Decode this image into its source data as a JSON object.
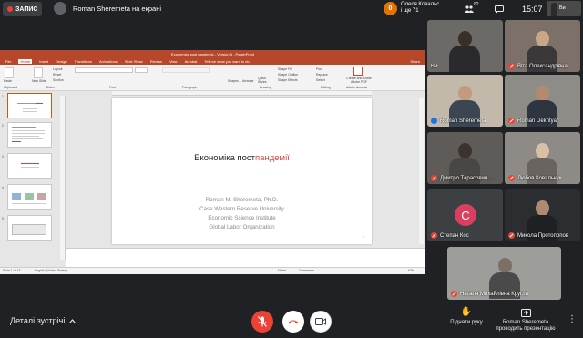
{
  "topbar": {
    "rec_label": "ЗАПИС",
    "presenting_label": "Roman Sheremeta на екрані",
    "notification_count": "0",
    "notification_name": "Олеся Ковальс…",
    "notification_more": "і ще 71",
    "people_count": "82",
    "clock": "15:07",
    "self_label": "Ви"
  },
  "ppt": {
    "window_title": "Economics post pandemic - Version 3 - PowerPoint",
    "tabs": [
      "File",
      "Home",
      "Insert",
      "Design",
      "Transitions",
      "Animations",
      "Slide Show",
      "Review",
      "View",
      "Acrobat"
    ],
    "tell_me": "Tell me what you want to do",
    "share": "Share",
    "ribbon": {
      "paste": "Paste",
      "new_slide": "New Slide",
      "layout": "Layout",
      "reset": "Reset",
      "section": "Section",
      "clipboard": "Clipboard",
      "slides": "Slides",
      "font": "Font",
      "paragraph": "Paragraph",
      "drawing": "Drawing",
      "shapes": "Shapes",
      "arrange": "Arrange",
      "quick_styles": "Quick Styles",
      "shape_fill": "Shape Fill",
      "shape_outline": "Shape Outline",
      "shape_effects": "Shape Effects",
      "find": "Find",
      "replace": "Replace",
      "select": "Select",
      "editing": "Editing",
      "create_share": "Create and Share Adobe PDF",
      "adobe_acrobat": "Adobe Acrobat"
    },
    "slide": {
      "title_pre": "Економіка пост",
      "title_highlight": "пандемії",
      "lines": [
        "Roman M. Sheremeta, Ph.D.",
        "Case Western Reserve University",
        "Economic Science Institute",
        "Global Labor Organization"
      ],
      "page_number": "1"
    },
    "thumb_numbers": [
      "1",
      "2",
      "3",
      "4",
      "5"
    ],
    "status": {
      "slide_of": "Slide 1 of 13",
      "language": "English (United States)",
      "notes": "Notes",
      "comments": "Comments",
      "zoom": "63%"
    }
  },
  "participants": [
    {
      "name": "Ви",
      "muted": false,
      "speaking": false,
      "bg": "#6b6a66",
      "head": "#3a2e28",
      "torso": "#2a2a2e"
    },
    {
      "name": "Віта Олександрівна",
      "muted": true,
      "bg": "#7d7069",
      "head": "#c9a58a",
      "torso": "#3a3838"
    },
    {
      "name": "Roman Sheremeta",
      "muted": false,
      "speaking": true,
      "bg": "#c2b9aa",
      "head": "#c49a7e",
      "torso": "#3b4652"
    },
    {
      "name": "Roman Dekhtyar",
      "muted": true,
      "bg": "#8d8c87",
      "head": "#b48a6e",
      "torso": "#2e3440"
    },
    {
      "name": "Дмитро Тарасович …",
      "muted": true,
      "bg": "#5e5b58",
      "head": "#3a3330",
      "torso": "#4a4646"
    },
    {
      "name": "Любов Ковальчук",
      "muted": true,
      "bg": "#8e8a86",
      "head": "#d8c0a8",
      "torso": "#6a6461"
    },
    {
      "name": "Степан Кос",
      "muted": true,
      "avatar_letter": "С",
      "bg": "#3c4043"
    },
    {
      "name": "Микола Протопопов",
      "muted": true,
      "bg": "#2b2d31",
      "head": "#b08a70",
      "torso": "#1e2024"
    },
    {
      "name": "Наталя Михайлівна Кругла",
      "muted": true,
      "bg": "#9d9d9a",
      "head": "#7d6f66",
      "torso": "#4b4a4a"
    }
  ],
  "bottombar": {
    "meeting_details": "Деталі зустрічі",
    "raise_hand": "Підняти руку",
    "presenting_1": "Roman Sheremeta",
    "presenting_2": "проводить презентацію"
  }
}
